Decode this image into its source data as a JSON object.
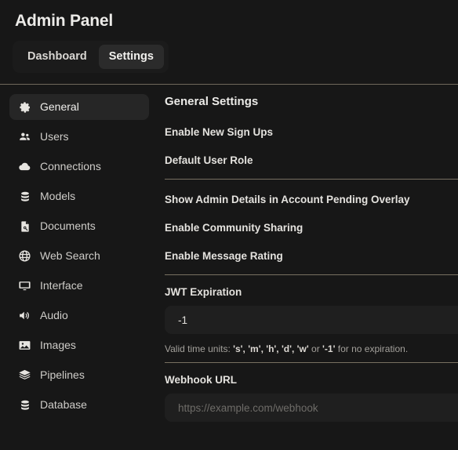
{
  "header": {
    "title": "Admin Panel",
    "tabs": [
      {
        "label": "Dashboard",
        "active": false
      },
      {
        "label": "Settings",
        "active": true
      }
    ]
  },
  "sidebar": {
    "items": [
      {
        "label": "General",
        "icon": "gear-icon",
        "active": true
      },
      {
        "label": "Users",
        "icon": "users-icon",
        "active": false
      },
      {
        "label": "Connections",
        "icon": "cloud-icon",
        "active": false
      },
      {
        "label": "Models",
        "icon": "database-icon",
        "active": false
      },
      {
        "label": "Documents",
        "icon": "document-search-icon",
        "active": false
      },
      {
        "label": "Web Search",
        "icon": "globe-icon",
        "active": false
      },
      {
        "label": "Interface",
        "icon": "monitor-icon",
        "active": false
      },
      {
        "label": "Audio",
        "icon": "speaker-icon",
        "active": false
      },
      {
        "label": "Images",
        "icon": "image-icon",
        "active": false
      },
      {
        "label": "Pipelines",
        "icon": "layers-icon",
        "active": false
      },
      {
        "label": "Database",
        "icon": "database-icon",
        "active": false
      }
    ]
  },
  "main": {
    "section_title": "General Settings",
    "settings_group_1": [
      {
        "label": "Enable New Sign Ups"
      },
      {
        "label": "Default User Role"
      }
    ],
    "settings_group_2": [
      {
        "label": "Show Admin Details in Account Pending Overlay"
      },
      {
        "label": "Enable Community Sharing"
      },
      {
        "label": "Enable Message Rating"
      }
    ],
    "jwt": {
      "label": "JWT Expiration",
      "value": "-1",
      "placeholder": "",
      "hint_prefix": "Valid time units: ",
      "hint_units": "'s', 'm', 'h', 'd', 'w'",
      "hint_mid": " or ",
      "hint_noexp": "'-1'",
      "hint_suffix": " for no expiration."
    },
    "webhook": {
      "label": "Webhook URL",
      "value": "",
      "placeholder": "https://example.com/webhook"
    }
  },
  "colors": {
    "background": "#171717",
    "panel": "#1f1f1f",
    "active_item": "#262626",
    "divider": "#b9ac93",
    "text": "#e8e6e3",
    "muted": "#a3a09b"
  }
}
